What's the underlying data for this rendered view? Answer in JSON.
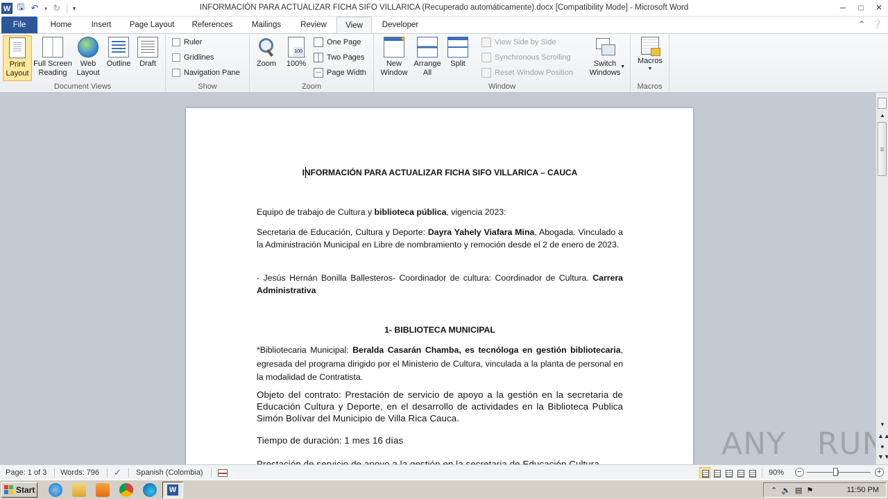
{
  "window": {
    "title": "INFORMACIÓN PARA ACTUALIZAR FICHA SIFO VILLARICA (Recuperado automáticamente).docx [Compatibility Mode]  -  Microsoft Word"
  },
  "tabs": [
    "File",
    "Home",
    "Insert",
    "Page Layout",
    "References",
    "Mailings",
    "Review",
    "View",
    "Developer"
  ],
  "active_tab": "View",
  "ribbon": {
    "document_views": {
      "label": "Document Views",
      "print_layout": "Print\nLayout",
      "full_screen_reading": "Full Screen\nReading",
      "web_layout": "Web\nLayout",
      "outline": "Outline",
      "draft": "Draft"
    },
    "show": {
      "label": "Show",
      "ruler": "Ruler",
      "gridlines": "Gridlines",
      "navigation_pane": "Navigation Pane"
    },
    "zoom": {
      "label": "Zoom",
      "zoom": "Zoom",
      "hundred": "100%",
      "one_page": "One Page",
      "two_pages": "Two Pages",
      "page_width": "Page Width"
    },
    "window": {
      "label": "Window",
      "new_window": "New\nWindow",
      "arrange_all": "Arrange\nAll",
      "split": "Split",
      "view_side_by_side": "View Side by Side",
      "synchronous_scrolling": "Synchronous Scrolling",
      "reset_window_position": "Reset Window Position",
      "switch_windows": "Switch\nWindows"
    },
    "macros": {
      "label": "Macros",
      "macros": "Macros"
    }
  },
  "document": {
    "heading": "INFORMACIÓN  PARA  ACTUALIZAR  FICHA  SIFO  VILLARICA  –  CAUCA",
    "p1": {
      "a": "Equipo  de trabajo de Cultura  y ",
      "b": "biblioteca pública",
      "c": ", vigencia 2023:"
    },
    "p2": {
      "a": "Secretaria de Educación, Cultura y Deporte: ",
      "b": "Dayra Yahely Viafara Mina",
      "c": ", Abogada. Vinculado a la Administración Municipal en Libre de nombramiento y remoción desde el 2 de enero de 2023."
    },
    "p3": {
      "a": "- Jesús Hernán Bonilla Ballesteros- Coordinador de cultura: Coordinador de Cultura. ",
      "b": "Carrera Administrativa"
    },
    "section1": "1- BIBLIOTECA MUNICIPAL",
    "p4": {
      "a": "*Bibliotecaria Municipal: ",
      "b": "Beralda Casarán Chamba, es tecnóloga en gestión bibliotecaria",
      "c": ", egresada del programa dirigido por el Ministerio de Cultura, vinculada a la planta de personal  en la modalidad de Contratista."
    },
    "p5": "Objeto del contrato: Prestación de servicio de apoyo a la gestión en la secretaria de Educación Cultura y Deporte, en el desarrollo de actividades en la Biblioteca Publica Simón Bolívar del Municipio de Villa Rica Cauca.",
    "p6": "Tiempo de duración:  1 mes 16 días",
    "p7": "Prestación de servicio de apoyo a la gestión en la secretaria de Educación Cultura"
  },
  "statusbar": {
    "page": "Page: 1 of 3",
    "words": "Words: 796",
    "language": "Spanish (Colombia)",
    "zoom": "90%"
  },
  "watermark": "ANY   RUN",
  "taskbar": {
    "start": "Start",
    "time": "11:50 PM"
  },
  "colors": {
    "file_tab": "#2b579a",
    "selected_button": "#fde79a",
    "canvas": "#c4cad3"
  }
}
